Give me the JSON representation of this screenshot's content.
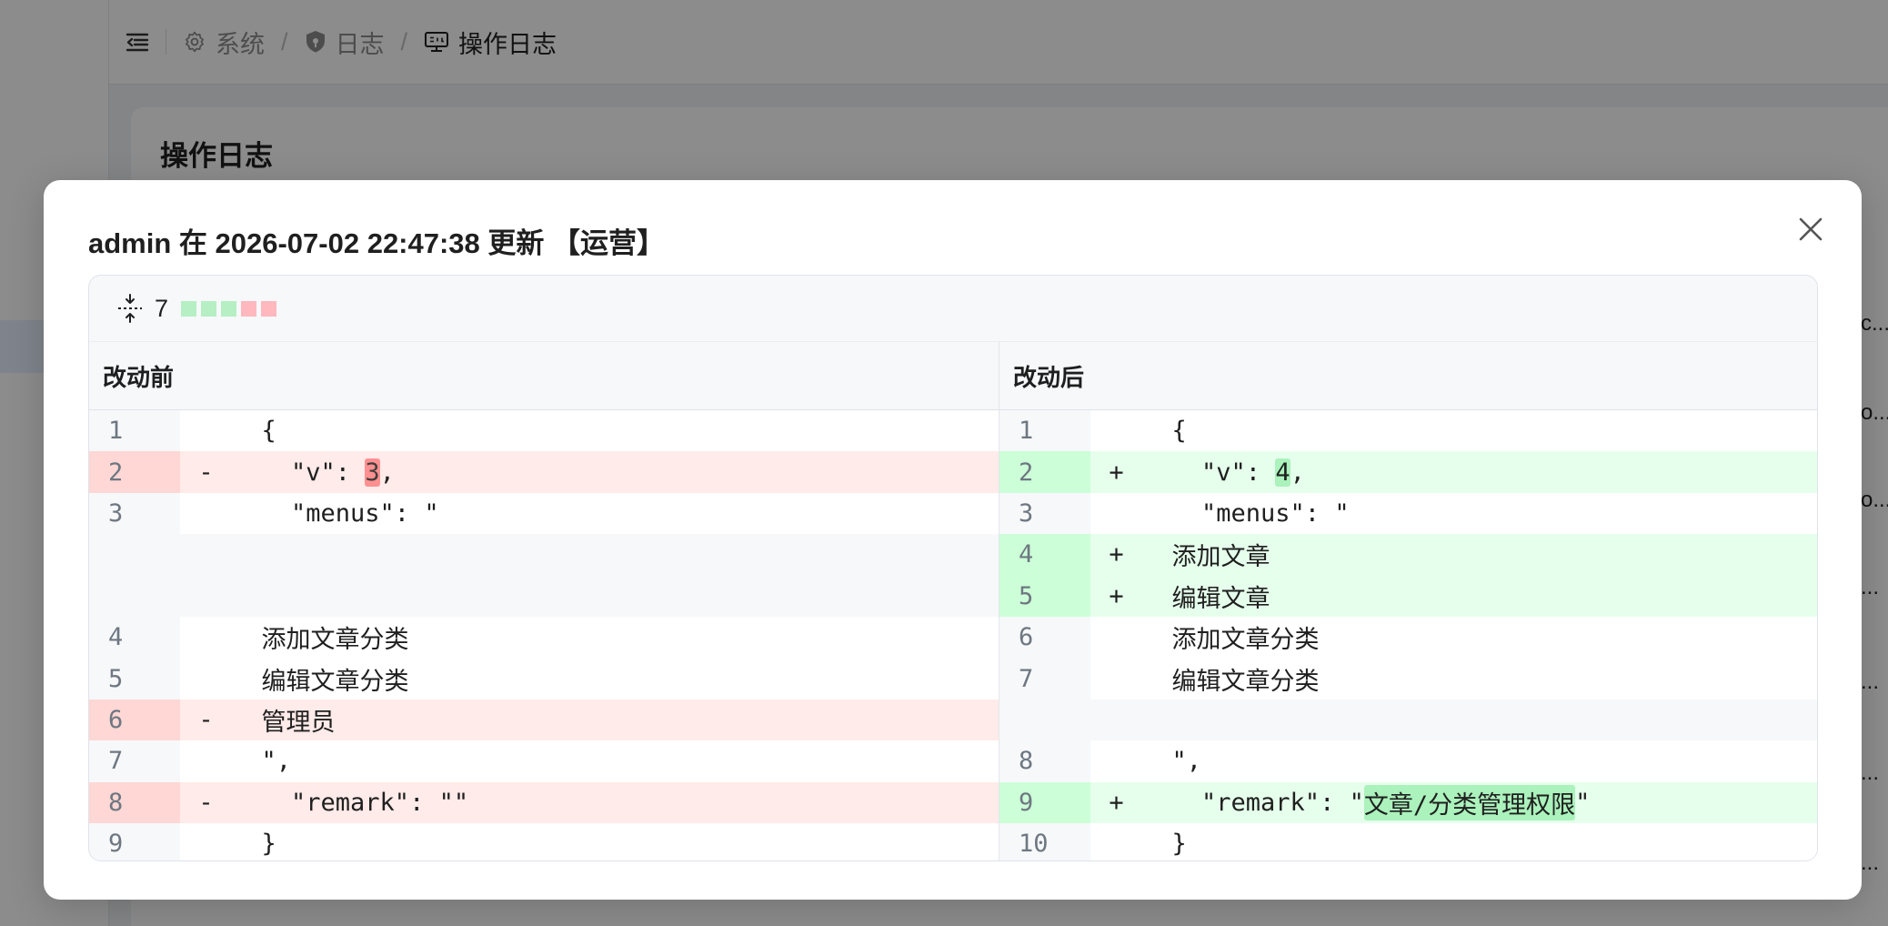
{
  "breadcrumb": [
    {
      "label": "系统",
      "icon": "gear-icon"
    },
    {
      "label": "日志",
      "icon": "shield-icon"
    },
    {
      "label": "操作日志",
      "icon": "sql-monitor-icon"
    }
  ],
  "breadcrumb_separator": "/",
  "page": {
    "card_title": "操作日志",
    "cells": [
      "c...",
      "o...",
      "o...",
      "...",
      "...",
      "...",
      "...",
      "...",
      "...",
      "..."
    ]
  },
  "modal": {
    "title": "admin 在 2026-07-02 22:47:38 更新 【运营】",
    "close_icon": "close-icon"
  },
  "diff": {
    "change_count": "7",
    "stat_blocks": [
      "add",
      "add",
      "add",
      "del",
      "del"
    ],
    "colors": {
      "add_line": "#e6ffec",
      "del_line": "#ffebe9",
      "add_word": "#abf2bc",
      "del_word": "#ff8182"
    },
    "before_label": "改动前",
    "after_label": "改动后",
    "rows": [
      {
        "l": {
          "n": "1",
          "m": "",
          "t": "  {",
          "s": ""
        },
        "r": {
          "n": "1",
          "m": "",
          "t": "  {",
          "s": ""
        }
      },
      {
        "l": {
          "n": "2",
          "m": "-",
          "t": "    \"v\": ",
          "h": "3",
          "a": ",",
          "s": "del"
        },
        "r": {
          "n": "2",
          "m": "+",
          "t": "    \"v\": ",
          "h": "4",
          "a": ",",
          "s": "add"
        }
      },
      {
        "l": {
          "n": "3",
          "m": "",
          "t": "    \"menus\": \"",
          "s": ""
        },
        "r": {
          "n": "3",
          "m": "",
          "t": "    \"menus\": \"",
          "s": ""
        }
      },
      {
        "l": {
          "n": "",
          "m": "",
          "t": "",
          "s": "empty"
        },
        "r": {
          "n": "4",
          "m": "+",
          "t": "  添加文章",
          "s": "add"
        }
      },
      {
        "l": {
          "n": "",
          "m": "",
          "t": "",
          "s": "empty"
        },
        "r": {
          "n": "5",
          "m": "+",
          "t": "  编辑文章",
          "s": "add"
        }
      },
      {
        "l": {
          "n": "4",
          "m": "",
          "t": "  添加文章分类",
          "s": ""
        },
        "r": {
          "n": "6",
          "m": "",
          "t": "  添加文章分类",
          "s": ""
        }
      },
      {
        "l": {
          "n": "5",
          "m": "",
          "t": "  编辑文章分类",
          "s": ""
        },
        "r": {
          "n": "7",
          "m": "",
          "t": "  编辑文章分类",
          "s": ""
        }
      },
      {
        "l": {
          "n": "6",
          "m": "-",
          "t": "  管理员",
          "s": "del"
        },
        "r": {
          "n": "",
          "m": "",
          "t": "",
          "s": "empty"
        }
      },
      {
        "l": {
          "n": "7",
          "m": "",
          "t": "  \",",
          "s": ""
        },
        "r": {
          "n": "8",
          "m": "",
          "t": "  \",",
          "s": ""
        }
      },
      {
        "l": {
          "n": "8",
          "m": "-",
          "t": "    \"remark\": \"\"",
          "s": "del"
        },
        "r": {
          "n": "9",
          "m": "+",
          "t": "    \"remark\": \"",
          "h": "文章/分类管理权限",
          "a": "\"",
          "s": "add"
        }
      },
      {
        "l": {
          "n": "9",
          "m": "",
          "t": "  }",
          "s": ""
        },
        "r": {
          "n": "10",
          "m": "",
          "t": "  }",
          "s": ""
        }
      }
    ]
  }
}
